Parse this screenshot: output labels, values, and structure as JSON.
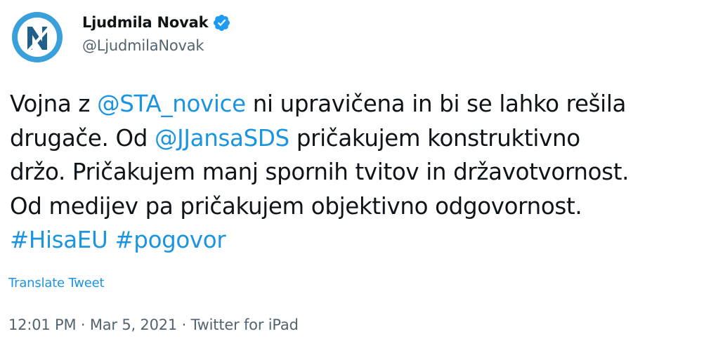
{
  "author": {
    "display_name": "Ljudmila Novak",
    "handle": "@LjudmilaNovak",
    "avatar_icon": "nsi-logo-icon",
    "verified_icon": "verified-badge-icon"
  },
  "tweet": {
    "lines": [
      [
        {
          "text": "Vojna z ",
          "type": "text"
        },
        {
          "text": "@STA_novice",
          "type": "mention"
        },
        {
          "text": " ni upravičena in bi se lahko rešila",
          "type": "text"
        }
      ],
      [
        {
          "text": "drugače. Od ",
          "type": "text"
        },
        {
          "text": "@JJansaSDS",
          "type": "mention"
        },
        {
          "text": " pričakujem konstruktivno",
          "type": "text"
        }
      ],
      [
        {
          "text": "držo. Pričakujem manj spornih tvitov in državotvornost.",
          "type": "text"
        }
      ],
      [
        {
          "text": "Od medijev pa pričakujem objektivno odgovornost.",
          "type": "text"
        }
      ],
      [
        {
          "text": "#HisaEU",
          "type": "hashtag"
        },
        {
          "text": " ",
          "type": "text"
        },
        {
          "text": "#pogovor",
          "type": "hashtag"
        }
      ]
    ],
    "translate_label": "Translate Tweet",
    "time": "12:01 PM",
    "separator": " · ",
    "date": "Mar 5, 2021",
    "source": "Twitter for iPad"
  },
  "colors": {
    "link": "#1b95e0",
    "secondary_text": "#536471",
    "primary_text": "#0f1419",
    "avatar_blue": "#3aa0dc"
  }
}
